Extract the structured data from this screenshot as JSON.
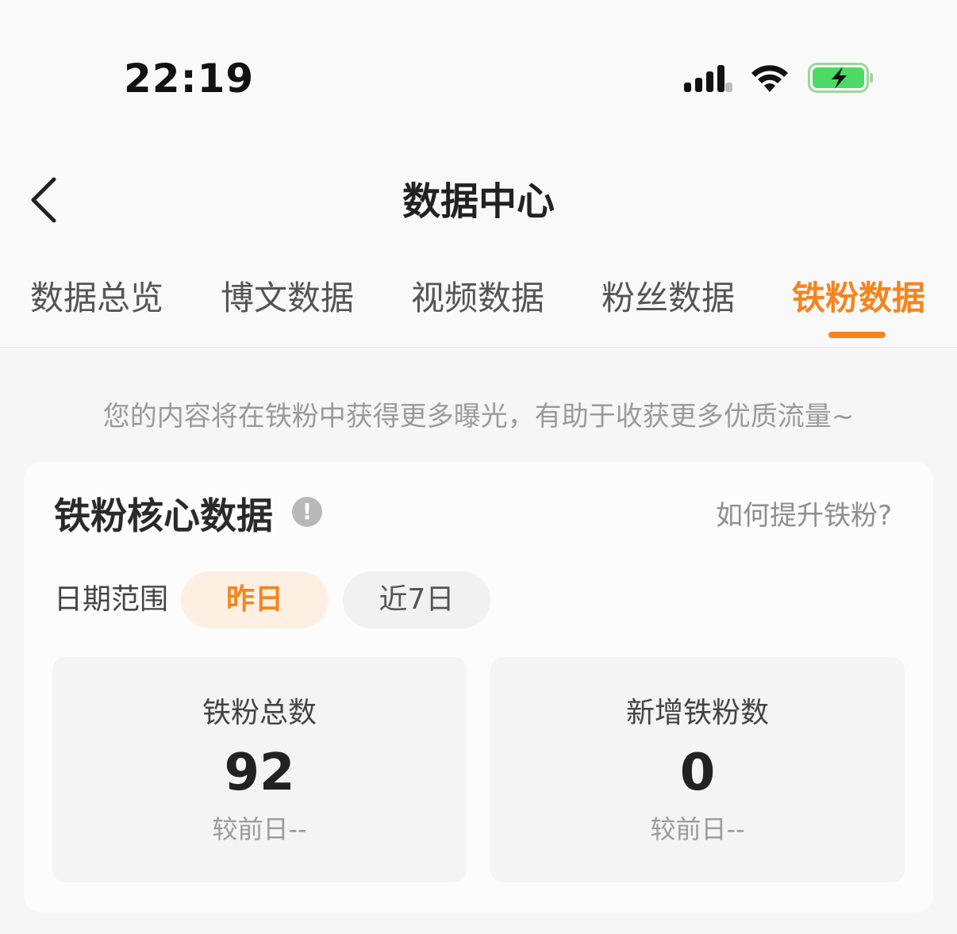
{
  "status_bar": {
    "time": "22:19"
  },
  "header": {
    "title": "数据中心"
  },
  "tabs": [
    {
      "label": "数据总览",
      "active": false
    },
    {
      "label": "博文数据",
      "active": false
    },
    {
      "label": "视频数据",
      "active": false
    },
    {
      "label": "粉丝数据",
      "active": false
    },
    {
      "label": "铁粉数据",
      "active": true
    }
  ],
  "hint": "您的内容将在铁粉中获得更多曝光，有助于收获更多优质流量~",
  "card": {
    "title": "铁粉核心数据",
    "info_icon": "!",
    "help_link": "如何提升铁粉?",
    "date_range_label": "日期范围",
    "ranges": [
      {
        "label": "昨日",
        "selected": true
      },
      {
        "label": "近7日",
        "selected": false
      }
    ],
    "stats": [
      {
        "label": "铁粉总数",
        "value": "92",
        "compare": "较前日--"
      },
      {
        "label": "新增铁粉数",
        "value": "0",
        "compare": "较前日--"
      }
    ]
  },
  "colors": {
    "accent": "#f5841f",
    "accent_bg": "#fdf0e3"
  }
}
